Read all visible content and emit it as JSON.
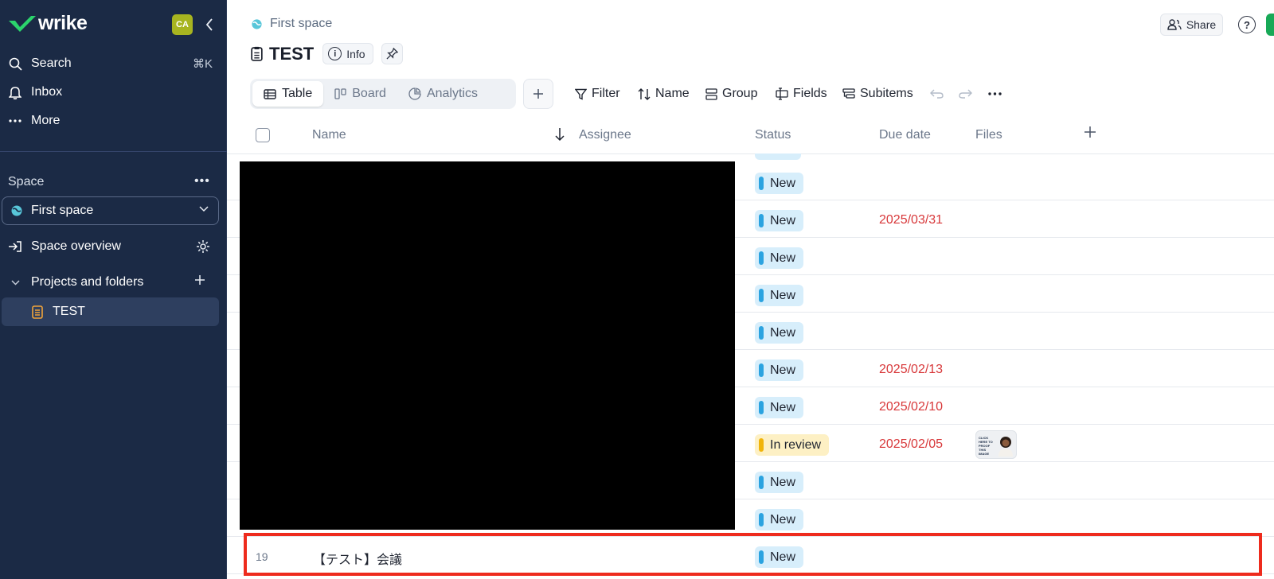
{
  "app": {
    "brand": "wrike",
    "avatar_initials": "CA",
    "accent_green": "#18a957",
    "sidebar_bg": "#1b2a45"
  },
  "sidebar": {
    "nav": [
      {
        "label": "Search",
        "icon": "search-icon",
        "shortcut": "⌘K"
      },
      {
        "label": "Inbox",
        "icon": "bell-icon"
      },
      {
        "label": "More",
        "icon": "more-dots-icon"
      }
    ],
    "space_section_label": "Space",
    "space_selected": "First space",
    "space_overview": "Space overview",
    "projects_label": "Projects and folders",
    "project_item": "TEST"
  },
  "header": {
    "breadcrumb": "First space",
    "title": "TEST",
    "info_label": "Info",
    "share_label": "Share",
    "help_label": "?"
  },
  "toolbar": {
    "tabs": [
      {
        "label": "Table",
        "icon": "table-icon",
        "active": true
      },
      {
        "label": "Board",
        "icon": "board-icon",
        "active": false
      },
      {
        "label": "Analytics",
        "icon": "analytics-icon",
        "active": false
      }
    ],
    "filter": "Filter",
    "sort": "Name",
    "group": "Group",
    "fields": "Fields",
    "subitems": "Subitems"
  },
  "table": {
    "columns": [
      "Name",
      "Assignee",
      "Status",
      "Due date",
      "Files"
    ],
    "rows": [
      {
        "status": "New",
        "due": ""
      },
      {
        "status": "New",
        "due": "2025/03/31"
      },
      {
        "status": "New",
        "due": ""
      },
      {
        "status": "New",
        "due": ""
      },
      {
        "status": "New",
        "due": ""
      },
      {
        "status": "New",
        "due": "2025/02/13"
      },
      {
        "status": "New",
        "due": "2025/02/10"
      },
      {
        "status": "In review",
        "due": "2025/02/05",
        "file_thumb_text": "CLICK HERE TO PROOF THIS IMAGE"
      },
      {
        "status": "New",
        "due": ""
      },
      {
        "status": "New",
        "due": ""
      },
      {
        "number": "19",
        "name": "【テスト】会議",
        "status": "New",
        "due": ""
      }
    ],
    "status_colors": {
      "New": "#2ba3e0",
      "In review": "#f1b409"
    },
    "due_color": "#d8383a"
  }
}
